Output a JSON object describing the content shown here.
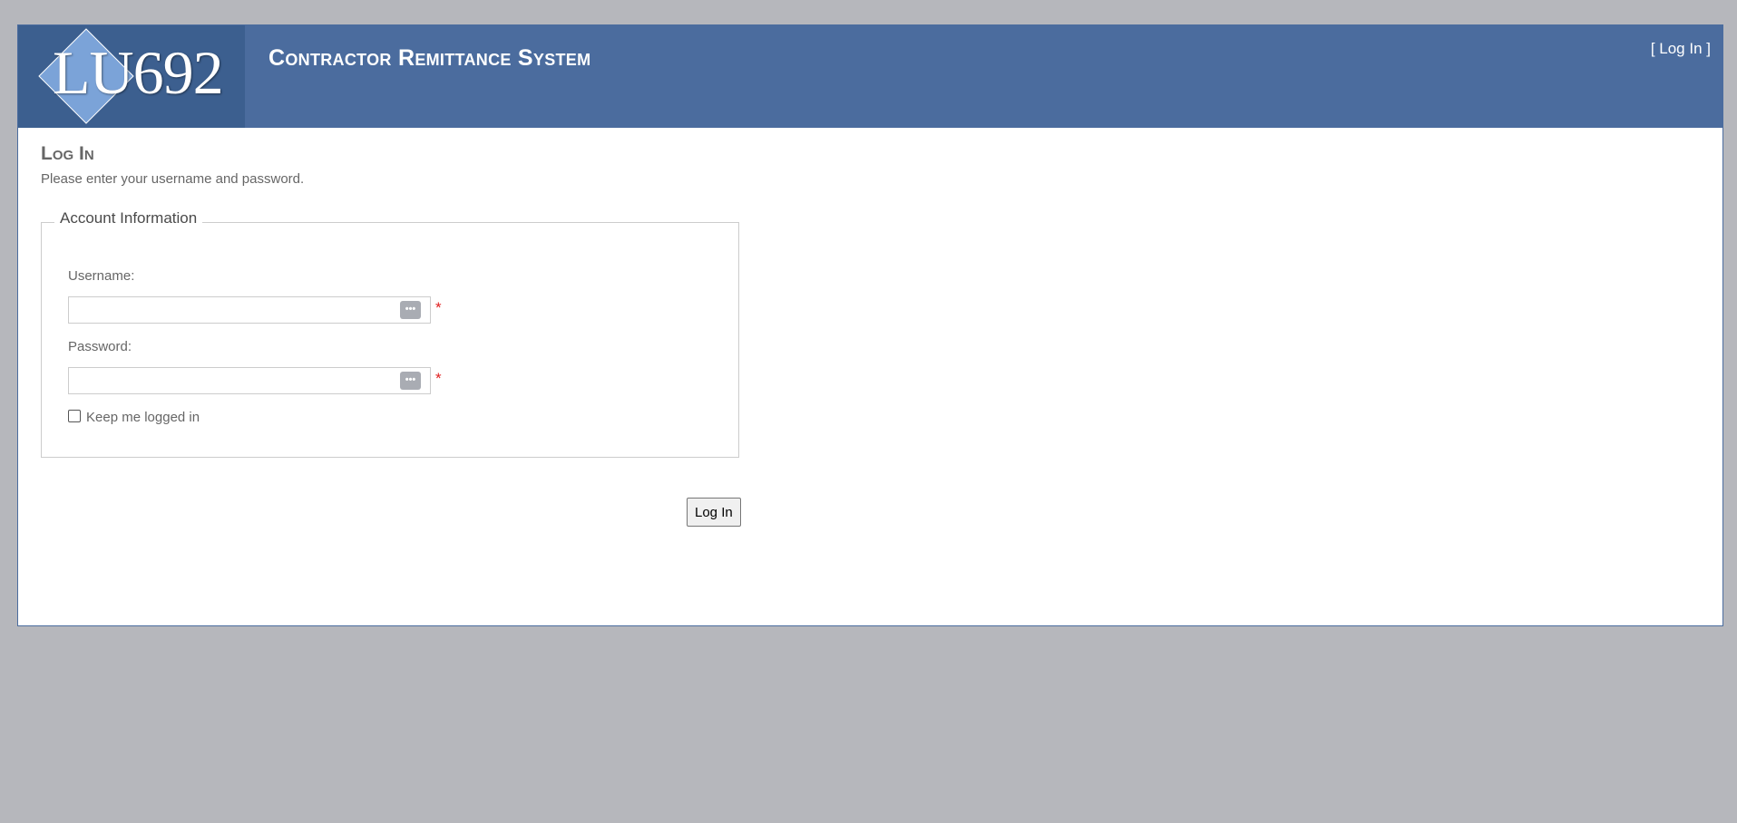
{
  "header": {
    "logo_text": "LU692",
    "app_title": "Contractor Remittance System",
    "login_link": "[ Log In ]"
  },
  "main": {
    "title": "Log In",
    "instructions": "Please enter your username and password."
  },
  "account": {
    "legend": "Account Information",
    "username_label": "Username:",
    "username_value": "",
    "password_label": "Password:",
    "password_value": "",
    "required_marker": "*",
    "remember_label": "Keep me logged in",
    "remember_checked": false,
    "password_manager_icon": "password-manager-icon"
  },
  "actions": {
    "submit_label": "Log In"
  },
  "colors": {
    "header_bg": "#4b6c9e",
    "page_bg": "#b6b7bc",
    "required": "#e02020"
  }
}
